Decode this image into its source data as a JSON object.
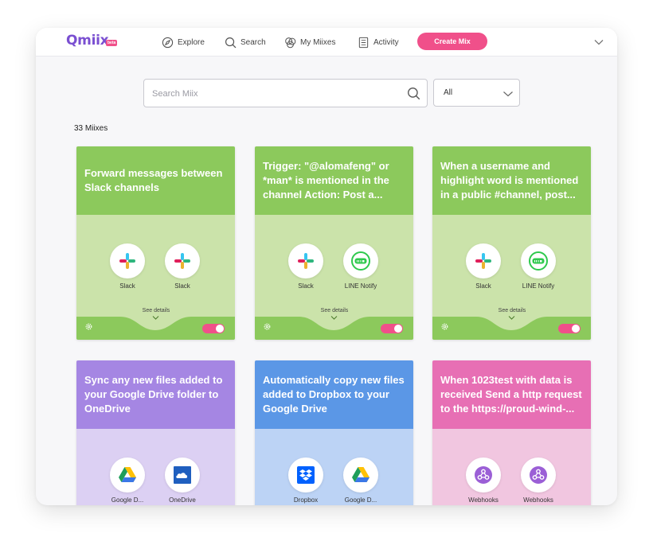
{
  "nav": {
    "logo": "Qmiix",
    "beta": "beta",
    "items": [
      {
        "label": "Explore",
        "icon": "compass-icon"
      },
      {
        "label": "Search",
        "icon": "search-icon"
      },
      {
        "label": "My Miixes",
        "icon": "circles-icon"
      },
      {
        "label": "Activity",
        "icon": "list-icon"
      }
    ],
    "create_label": "Create Mix"
  },
  "search": {
    "placeholder": "Search Miix"
  },
  "filter": {
    "value": "All"
  },
  "count": "33 Miixes",
  "cards": [
    {
      "title": "Forward messages between Slack channels",
      "services": [
        "Slack",
        "Slack"
      ],
      "details": "See details",
      "enabled": true
    },
    {
      "title": "Trigger: \"@alomafeng\" or *man* is mentioned in the channel Action: Post a...",
      "services": [
        "Slack",
        "LINE Notify"
      ],
      "details": "See details",
      "enabled": true
    },
    {
      "title": "When a username and highlight word is mentioned in a public #channel, post...",
      "services": [
        "Slack",
        "LINE Notify"
      ],
      "details": "See details",
      "enabled": true
    },
    {
      "title": "Sync any new files added to your Google Drive folder to OneDrive",
      "services": [
        "Google D...",
        "OneDrive"
      ]
    },
    {
      "title": "Automatically copy new files added to Dropbox to your Google Drive",
      "services": [
        "Dropbox",
        "Google D..."
      ]
    },
    {
      "title": "When 1023test with data is received Send a http request to the https://proud-wind-...",
      "services": [
        "Webhooks",
        "Webhooks"
      ]
    }
  ],
  "colors": {
    "accent": "#f0508a",
    "brand": "#7a4fd1",
    "green_head": "#8cc95c",
    "green_body": "#cbe3aa",
    "purple_head": "#a586e3",
    "purple_body": "#dcd0f3",
    "blue_head": "#5b97e6",
    "blue_body": "#bcd3f5",
    "pink_head": "#e76fb4",
    "pink_body": "#f1c6e0"
  }
}
